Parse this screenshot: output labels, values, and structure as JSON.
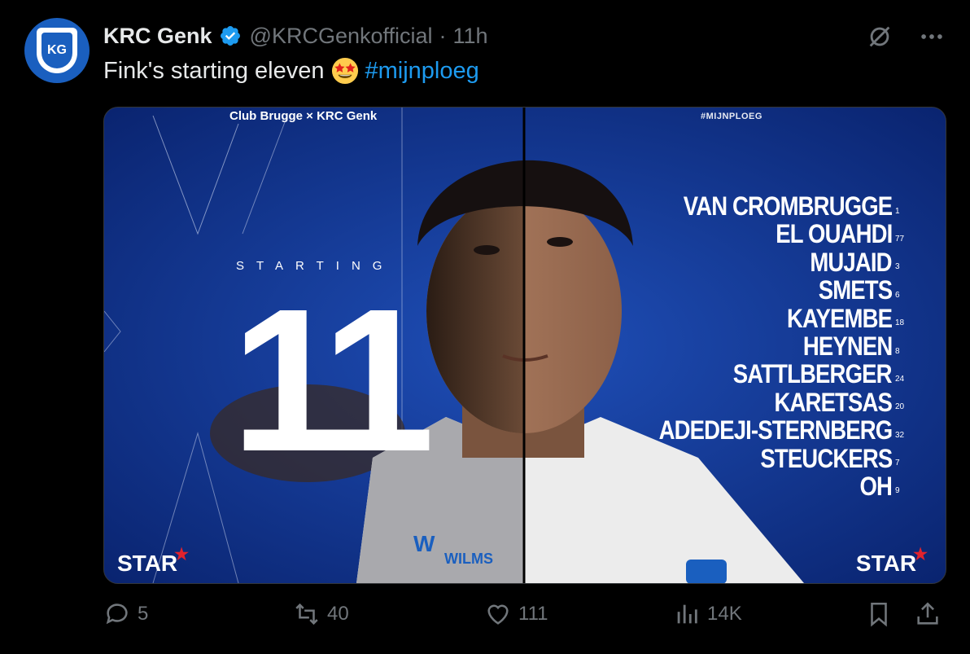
{
  "tweet": {
    "author_name": "KRC Genk",
    "handle": "@KRCGenkofficial",
    "separator": "·",
    "time": "11h",
    "text": "Fink's starting eleven",
    "hashtag": "#mijnploeg"
  },
  "media": {
    "match_title": "Club Brugge × KRC Genk",
    "hashtag_tag": "#MIJNPLOEG",
    "starting_label": "STARTING",
    "eleven": "11",
    "sponsor": "STAR",
    "lineup": [
      {
        "name": "VAN CROMBRUGGE",
        "number": "1"
      },
      {
        "name": "EL OUAHDI",
        "number": "77"
      },
      {
        "name": "MUJAID",
        "number": "3"
      },
      {
        "name": "SMETS",
        "number": "6"
      },
      {
        "name": "KAYEMBE",
        "number": "18"
      },
      {
        "name": "HEYNEN",
        "number": "8"
      },
      {
        "name": "SATTLBERGER",
        "number": "24"
      },
      {
        "name": "KARETSAS",
        "number": "20"
      },
      {
        "name": "ADEDEJI-STERNBERG",
        "number": "32"
      },
      {
        "name": "STEUCKERS",
        "number": "7"
      },
      {
        "name": "OH",
        "number": "9"
      }
    ]
  },
  "actions": {
    "replies": "5",
    "reposts": "40",
    "likes": "111",
    "views": "14K"
  },
  "icons": {
    "verified": "verified-badge-icon",
    "grok": "grok-icon",
    "more": "more-icon",
    "reply": "reply-icon",
    "repost": "repost-icon",
    "like": "like-icon",
    "views": "views-icon",
    "bookmark": "bookmark-icon",
    "share": "share-icon"
  },
  "colors": {
    "accent": "#1d9bf0",
    "muted": "#71767b",
    "text": "#e7e9ea",
    "background": "#000000",
    "club_blue": "#1a5fbf"
  }
}
